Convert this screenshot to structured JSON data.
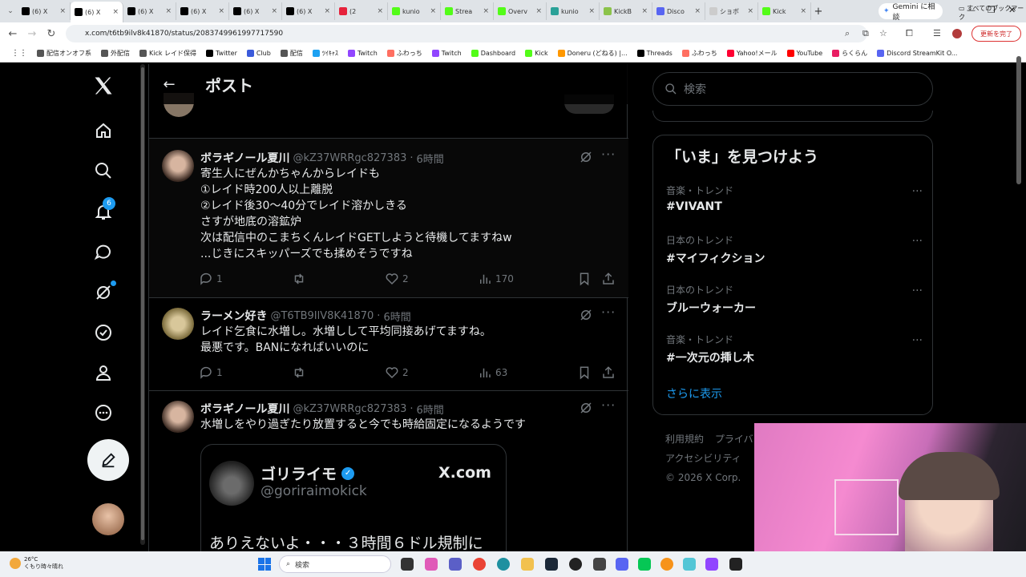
{
  "browser": {
    "tabs": [
      {
        "label": "(6) X",
        "color": "#000000",
        "active": false
      },
      {
        "label": "(6) X",
        "color": "#000000",
        "active": true
      },
      {
        "label": "(6) X",
        "color": "#000000",
        "active": false
      },
      {
        "label": "(6) X",
        "color": "#000000",
        "active": false
      },
      {
        "label": "(6) X",
        "color": "#000000",
        "active": false
      },
      {
        "label": "(6) X",
        "color": "#000000",
        "active": false
      },
      {
        "label": "(2",
        "color": "#e6223b",
        "active": false
      },
      {
        "label": "kunio",
        "color": "#53fc18",
        "active": false
      },
      {
        "label": "Strea",
        "color": "#53fc18",
        "active": false
      },
      {
        "label": "Overv",
        "color": "#53fc18",
        "active": false
      },
      {
        "label": "kunio",
        "color": "#2aa198",
        "active": false
      },
      {
        "label": "KickB",
        "color": "#8bc34a",
        "active": false
      },
      {
        "label": "Disco",
        "color": "#5865f2",
        "active": false
      },
      {
        "label": "ショボ",
        "color": "#cccccc",
        "active": false
      },
      {
        "label": "Kick",
        "color": "#53fc18",
        "active": false
      }
    ],
    "gemini_label": "Gemini に相談",
    "url": "x.com/t6tb9ilv8k41870/status/2083749961997717590",
    "update_label": "更新を完了",
    "bookmarks": [
      {
        "label": "配信オンオフ系",
        "color": "#555555"
      },
      {
        "label": "外配信",
        "color": "#555555"
      },
      {
        "label": "Kick レイド保得",
        "color": "#555555"
      },
      {
        "label": "Twitter",
        "color": "#000000"
      },
      {
        "label": "Club",
        "color": "#3b5bdb"
      },
      {
        "label": "配信",
        "color": "#555555"
      },
      {
        "label": "ﾂｲｷｬｽ",
        "color": "#1da1f2"
      },
      {
        "label": "Twitch",
        "color": "#9146ff"
      },
      {
        "label": "ふわっち",
        "color": "#ff6f61"
      },
      {
        "label": "Twitch",
        "color": "#9146ff"
      },
      {
        "label": "Dashboard",
        "color": "#53fc18"
      },
      {
        "label": "Kick",
        "color": "#53fc18"
      },
      {
        "label": "Doneru (どねる) |...",
        "color": "#ff9800"
      },
      {
        "label": "Threads",
        "color": "#000000"
      },
      {
        "label": "ふわっち",
        "color": "#ff6f61"
      },
      {
        "label": "Yahoo!メール",
        "color": "#ff0033"
      },
      {
        "label": "YouTube",
        "color": "#ff0000"
      },
      {
        "label": "らくらん",
        "color": "#e91e63"
      },
      {
        "label": "Discord StreamKit O...",
        "color": "#5865f2"
      }
    ],
    "all_bookmarks": "すべてのブックマーク"
  },
  "nav": {
    "notification_count": "6"
  },
  "header": {
    "title": "ポスト"
  },
  "posts": [
    {
      "name": "ボラギノール夏川",
      "handle": "@kZ37WRRgc827383",
      "time": "6時間",
      "lines": [
        "寄生人にぜんかちゃんからレイドも",
        "①レイド時200人以上離脱",
        "②レイド後30〜40分でレイド溶かしきる",
        "さすが地底の溶鉱炉",
        "次は配信中のこまちくんレイドGETしようと待機してますねw",
        "...じきにスキッパーズでも揉めそうですね"
      ],
      "replies": "1",
      "reposts": "",
      "likes": "2",
      "views": "170"
    },
    {
      "name": "ラーメン好き",
      "handle": "@T6TB9IlV8K41870",
      "time": "6時間",
      "lines": [
        "レイド乞食に水増し。水増しして平均同接あげてますね。",
        "最悪です。BANになればいいのに"
      ],
      "replies": "1",
      "reposts": "",
      "likes": "2",
      "views": "63"
    },
    {
      "name": "ボラギノール夏川",
      "handle": "@kZ37WRRgc827383",
      "time": "6時間",
      "lines": [
        "水増しをやり過ぎたり放置すると今でも時給固定になるようです"
      ],
      "card": {
        "name": "ゴリライモ",
        "handle": "@goriraimokick",
        "site": "X.com",
        "text": "ありえないよ・・・３時間６ドル規制に"
      }
    }
  ],
  "sidebar": {
    "search_placeholder": "検索",
    "trends_title": "「いま」を見つけよう",
    "trends": [
      {
        "meta": "音楽・トレンド",
        "name": "#VIVANT"
      },
      {
        "meta": "日本のトレンド",
        "name": "#マイフィクション"
      },
      {
        "meta": "日本のトレンド",
        "name": "ブルーウォーカー"
      },
      {
        "meta": "音楽・トレンド",
        "name": "#一次元の挿し木"
      }
    ],
    "show_more": "さらに表示",
    "footer": {
      "terms": "利用規約",
      "privacy": "プライバ",
      "accessibility": "アクセシビリティ",
      "copyright": "© 2026 X Corp."
    }
  },
  "taskbar": {
    "temperature": "26°C",
    "weather": "くもり時々晴れ",
    "search_label": "検索"
  }
}
